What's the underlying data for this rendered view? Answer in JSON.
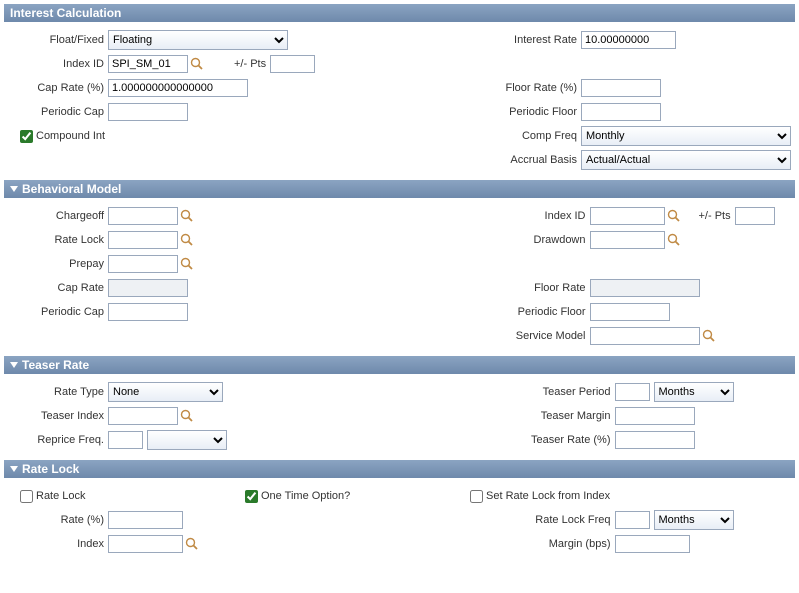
{
  "sections": {
    "interest_calc": "Interest Calculation",
    "behavioral": "Behavioral Model",
    "teaser": "Teaser Rate",
    "rate_lock": "Rate Lock"
  },
  "ic": {
    "float_fixed_lbl": "Float/Fixed",
    "float_fixed_val": "Floating",
    "interest_rate_lbl": "Interest Rate",
    "interest_rate_val": "10.00000000",
    "index_id_lbl": "Index ID",
    "index_id_val": "SPI_SM_01",
    "pts_lbl": "+/- Pts",
    "pts_val": "",
    "cap_rate_lbl": "Cap Rate (%)",
    "cap_rate_val": "1.000000000000000",
    "floor_rate_lbl": "Floor Rate (%)",
    "floor_rate_val": "",
    "periodic_cap_lbl": "Periodic Cap",
    "periodic_cap_val": "",
    "periodic_floor_lbl": "Periodic Floor",
    "periodic_floor_val": "",
    "compound_int_lbl": "Compound Int",
    "compound_int_checked": true,
    "comp_freq_lbl": "Comp Freq",
    "comp_freq_val": "Monthly",
    "accrual_basis_lbl": "Accrual Basis",
    "accrual_basis_val": "Actual/Actual"
  },
  "bm": {
    "chargeoff_lbl": "Chargeoff",
    "chargeoff_val": "",
    "rate_lock_lbl": "Rate Lock",
    "rate_lock_val": "",
    "prepay_lbl": "Prepay",
    "prepay_val": "",
    "cap_rate_lbl": "Cap Rate",
    "cap_rate_val": "",
    "periodic_cap_lbl": "Periodic Cap",
    "periodic_cap_val": "",
    "index_id_lbl": "Index ID",
    "index_id_val": "",
    "pts_lbl": "+/- Pts",
    "pts_val": "",
    "drawdown_lbl": "Drawdown",
    "drawdown_val": "",
    "floor_rate_lbl": "Floor Rate",
    "floor_rate_val": "",
    "periodic_floor_lbl": "Periodic Floor",
    "periodic_floor_val": "",
    "service_model_lbl": "Service Model",
    "service_model_val": ""
  },
  "tr": {
    "rate_type_lbl": "Rate Type",
    "rate_type_val": "None",
    "teaser_period_lbl": "Teaser Period",
    "teaser_period_val": "",
    "teaser_period_unit": "Months",
    "teaser_index_lbl": "Teaser Index",
    "teaser_index_val": "",
    "teaser_margin_lbl": "Teaser Margin",
    "teaser_margin_val": "",
    "reprice_freq_lbl": "Reprice Freq.",
    "reprice_freq_val": "",
    "reprice_freq_unit": "",
    "teaser_rate_lbl": "Teaser Rate (%)",
    "teaser_rate_val": ""
  },
  "rl": {
    "rate_lock_lbl": "Rate Lock",
    "rate_lock_checked": false,
    "one_time_lbl": "One Time Option?",
    "one_time_checked": true,
    "set_from_index_lbl": "Set Rate Lock from Index",
    "set_from_index_checked": false,
    "rate_pct_lbl": "Rate (%)",
    "rate_pct_val": "",
    "rate_lock_freq_lbl": "Rate Lock Freq",
    "rate_lock_freq_val": "",
    "rate_lock_freq_unit": "Months",
    "index_lbl": "Index",
    "index_val": "",
    "margin_lbl": "Margin (bps)",
    "margin_val": ""
  }
}
